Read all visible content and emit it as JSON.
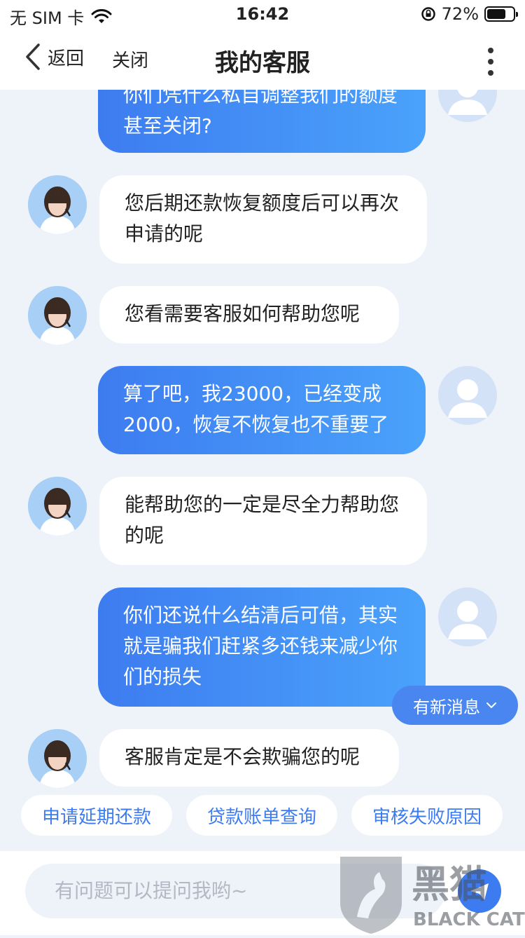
{
  "status_bar": {
    "carrier": "无 SIM 卡",
    "time": "16:42",
    "battery": "72%",
    "battery_level": 0.72
  },
  "nav": {
    "back_label": "返回",
    "close_label": "关闭",
    "title": "我的客服"
  },
  "messages": [
    {
      "sender": "user",
      "text": "你们凭什么私自调整我们的额度甚至关闭?"
    },
    {
      "sender": "agent",
      "text": "您后期还款恢复额度后可以再次申请的呢"
    },
    {
      "sender": "agent",
      "text": "您看需要客服如何帮助您呢"
    },
    {
      "sender": "user",
      "text": "算了吧，我23000，已经变成2000，恢复不恢复也不重要了"
    },
    {
      "sender": "agent",
      "text": "能帮助您的一定是尽全力帮助您的呢"
    },
    {
      "sender": "user",
      "text": "你们还说什么结清后可借，其实就是骗我们赶紧多还钱来减少你们的损失"
    },
    {
      "sender": "agent",
      "text": "客服肯定是不会欺骗您的呢"
    }
  ],
  "new_messages_label": "有新消息",
  "quick_replies": [
    "申请延期还款",
    "贷款账单查询",
    "审核失败原因"
  ],
  "input": {
    "placeholder": "有问题可以提问我哟~"
  },
  "watermark": {
    "text_cn": "黑猫",
    "text_en": "BLACK CAT"
  },
  "colors": {
    "accent": "#3d7cf0",
    "background": "#eef2f9"
  }
}
